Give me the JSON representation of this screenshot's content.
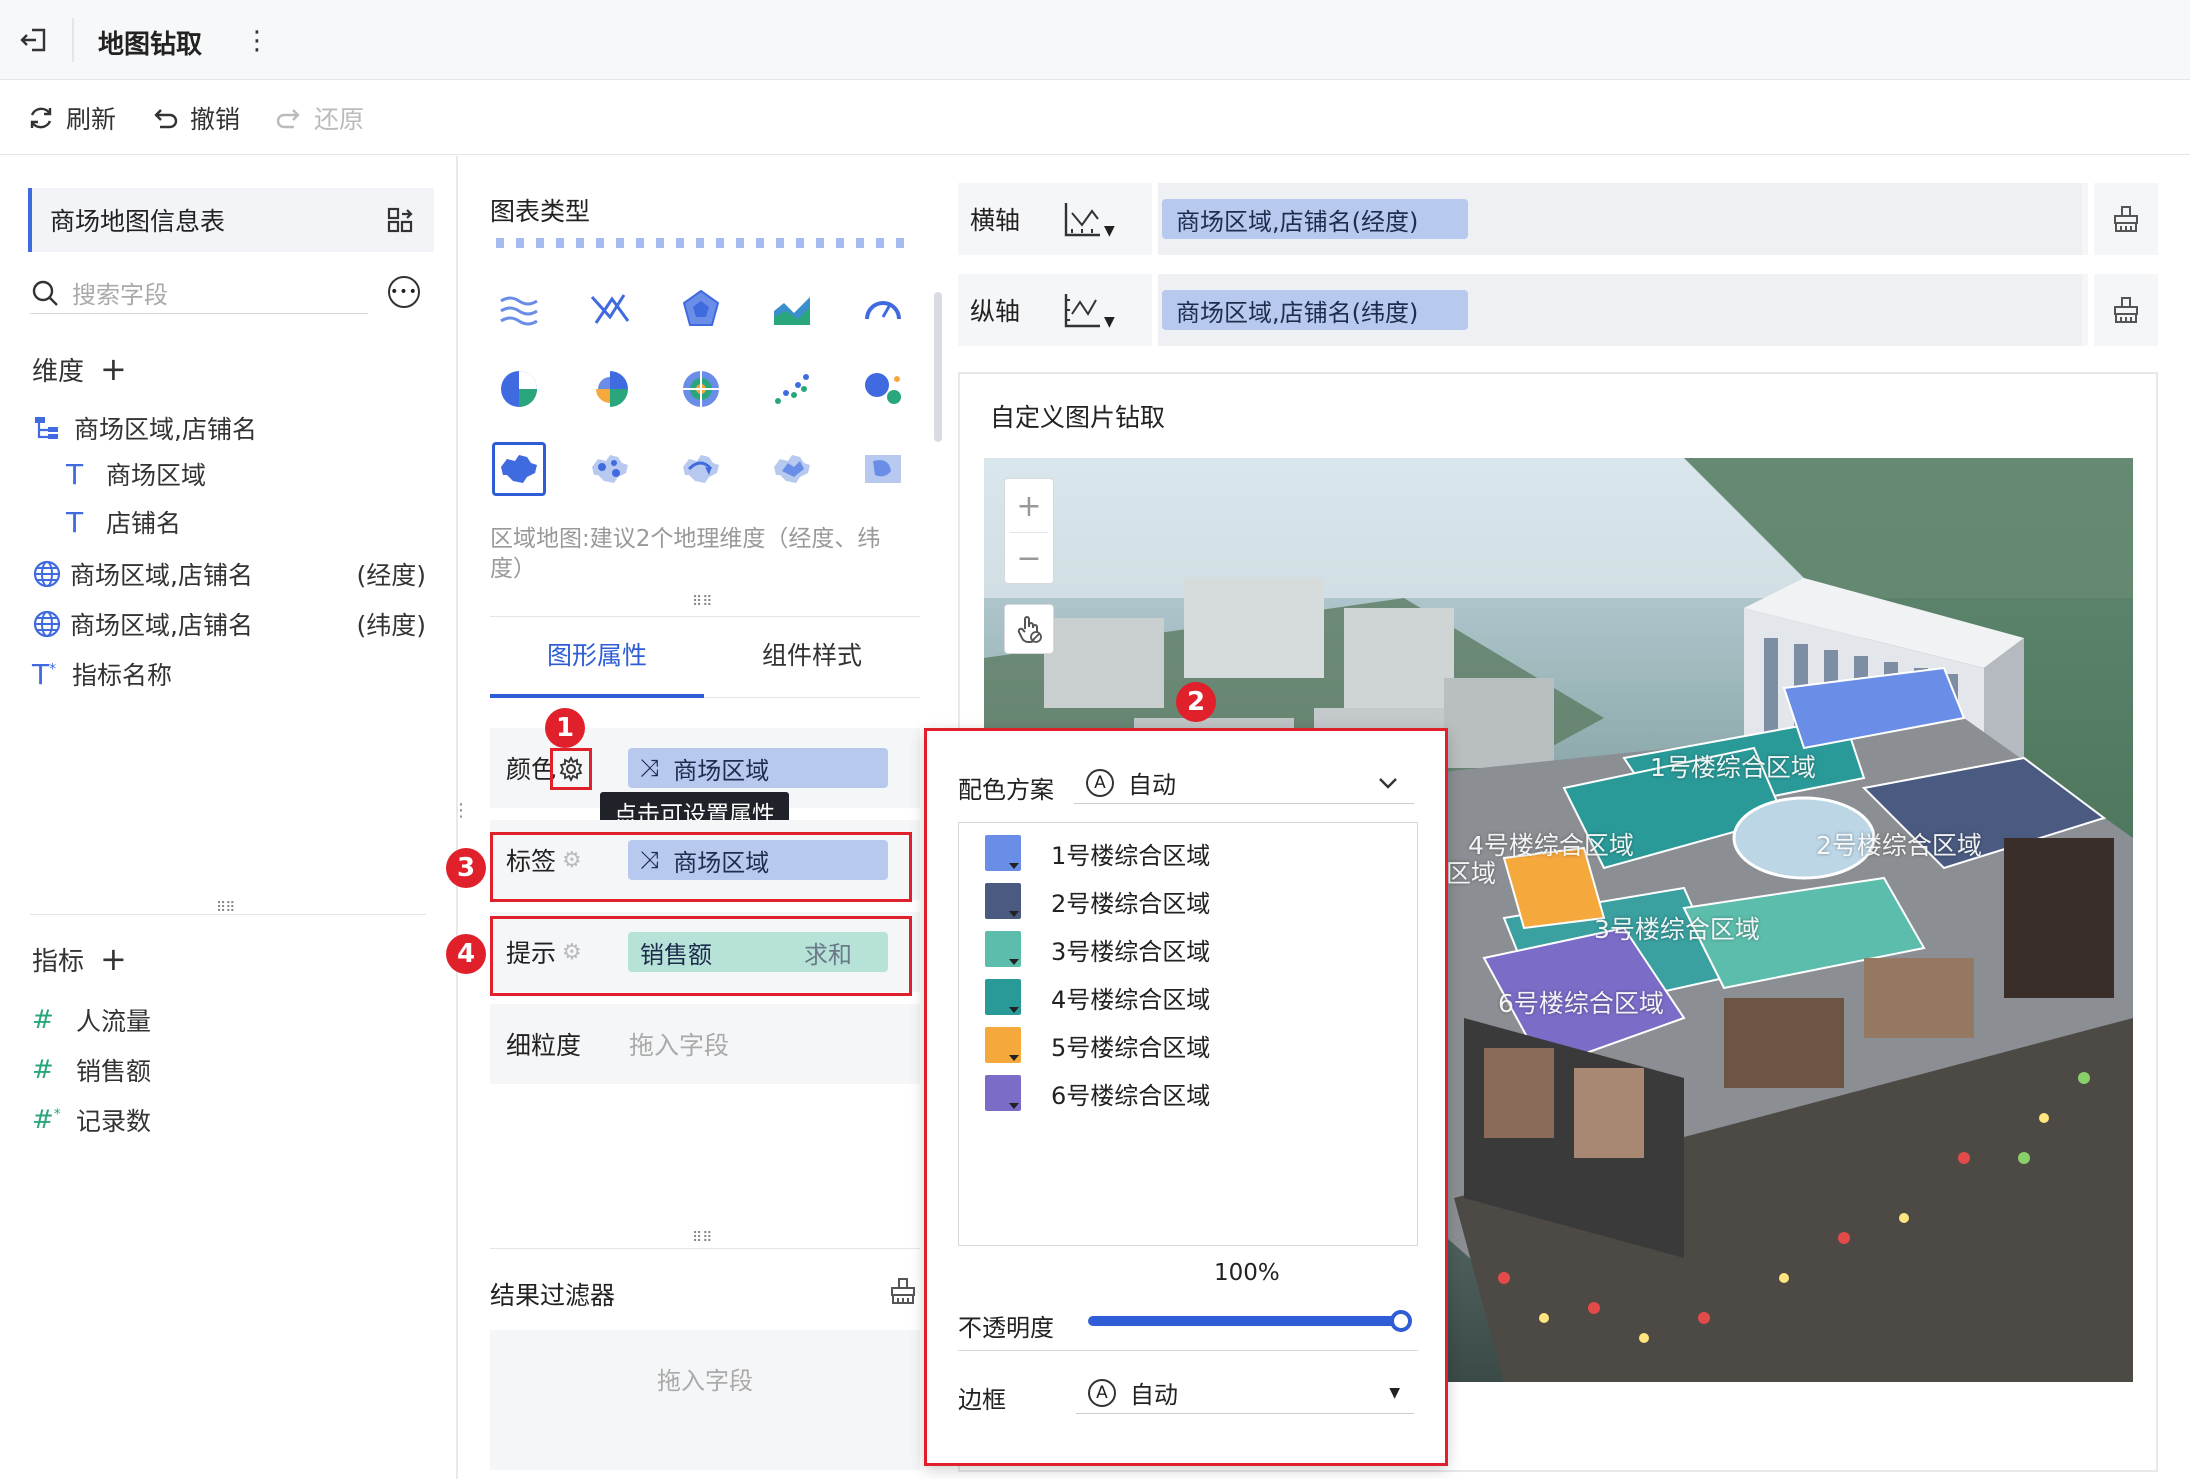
{
  "topbar": {
    "title": "地图钻取"
  },
  "toolbar": {
    "refresh": "刷新",
    "undo": "撤销",
    "redo": "还原"
  },
  "left": {
    "table_name": "商场地图信息表",
    "search_placeholder": "搜索字段",
    "dimensions_title": "维度",
    "dimension_fields": {
      "hierarchy": "商场区域,店铺名",
      "child1": "商场区域",
      "child2": "店铺名",
      "geo1": "商场区域,店铺名",
      "geo1_suffix": "(经度)",
      "geo2": "商场区域,店铺名",
      "geo2_suffix": "(纬度)",
      "measure_names": "指标名称"
    },
    "measures_title": "指标",
    "measure_fields": [
      "人流量",
      "销售额",
      "记录数"
    ]
  },
  "middle": {
    "chart_type_title": "图表类型",
    "chart_hint": "区域地图:建议2个地理维度（经度、纬度）",
    "tabs": [
      "图形属性",
      "组件样式"
    ],
    "color_label": "颜色",
    "color_field": "商场区域",
    "tooltip_text": "点击可设置属性",
    "label_label": "标签",
    "label_field": "商场区域",
    "hint_label": "提示",
    "hint_field": "销售额",
    "hint_agg": "求和",
    "granularity_label": "细粒度",
    "drop_placeholder": "拖入字段",
    "filter_title": "结果过滤器",
    "filter_placeholder": "拖入字段"
  },
  "right": {
    "x_axis_label": "横轴",
    "x_axis_field": "商场区域,店铺名(经度)",
    "y_axis_label": "纵轴",
    "y_axis_field": "商场区域,店铺名(纬度)",
    "card_title": "自定义图片钻取",
    "zoom_in": "+",
    "zoom_out": "−",
    "map_labels": [
      "1号楼综合区域",
      "4号楼综合区域",
      "2号楼综合区域",
      "区域",
      "3号楼综合区域",
      "6号楼综合区域"
    ]
  },
  "popup": {
    "scheme_label": "配色方案",
    "scheme_value": "自动",
    "items": [
      {
        "label": "1号楼综合区域",
        "color": "#6a8ee8"
      },
      {
        "label": "2号楼综合区域",
        "color": "#4a5a80"
      },
      {
        "label": "3号楼综合区域",
        "color": "#5cbdad"
      },
      {
        "label": "4号楼综合区域",
        "color": "#2a9a98"
      },
      {
        "label": "5号楼综合区域",
        "color": "#f5a83c"
      },
      {
        "label": "6号楼综合区域",
        "color": "#7b6cc8"
      }
    ],
    "opacity_value": "100%",
    "opacity_label": "不透明度",
    "border_label": "边框",
    "border_value": "自动"
  },
  "badges": [
    "1",
    "2",
    "3",
    "4"
  ],
  "colors": {
    "accent": "#2f5dd6",
    "highlight_red": "#e0202a"
  }
}
